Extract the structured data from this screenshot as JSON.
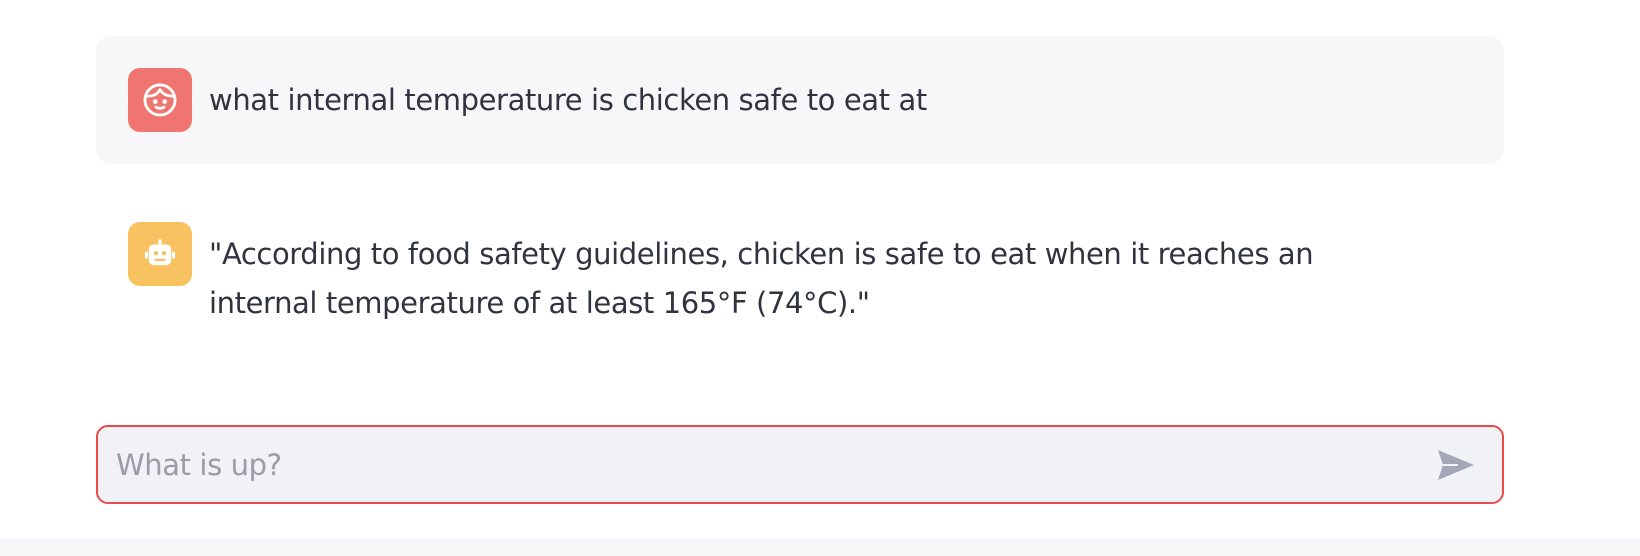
{
  "messages": [
    {
      "role": "user",
      "avatar_icon": "user-face-icon",
      "avatar_color": "#f07470",
      "text": "what internal temperature is chicken safe to eat at"
    },
    {
      "role": "assistant",
      "avatar_icon": "robot-icon",
      "avatar_color": "#f9c261",
      "text": "\"According to food safety guidelines, chicken is safe to eat when it reaches an internal temperature of at least 165°F (74°C).\""
    }
  ],
  "chat_input": {
    "placeholder": "What is up?",
    "value": "",
    "border_color": "#ea4a4a",
    "send_icon": "send-icon"
  }
}
